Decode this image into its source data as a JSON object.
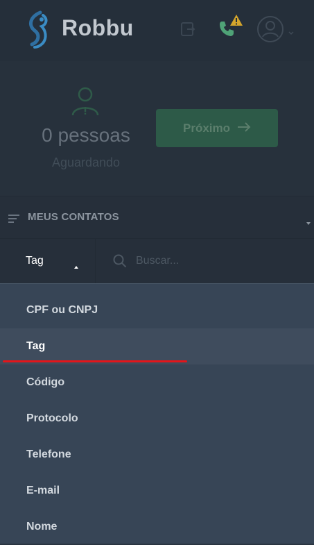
{
  "header": {
    "brand": "Robbu",
    "icons": [
      "robbu-logo-icon",
      "exit-icon",
      "phone-icon",
      "warning-icon",
      "user-avatar-icon",
      "chevron-down-icon"
    ]
  },
  "queue": {
    "count_label": "0 pessoas",
    "status_label": "Aguardando",
    "next_button_label": "Próximo",
    "next_button_icon": "arrow-right-icon"
  },
  "contacts": {
    "section_title": "MEUS CONTATOS",
    "filter": {
      "selected": "Tag",
      "search_placeholder": "Buscar..."
    },
    "filter_options": [
      {
        "label": "CPF ou CNPJ"
      },
      {
        "label": "Tag"
      },
      {
        "label": "Código"
      },
      {
        "label": "Protocolo"
      },
      {
        "label": "Telefone"
      },
      {
        "label": "E-mail"
      },
      {
        "label": "Nome"
      }
    ],
    "highlighted_option": "Tag"
  },
  "colors": {
    "accent_green": "#2d5a48",
    "highlight_red": "#e3151a",
    "warning_yellow": "#d4a52c"
  }
}
